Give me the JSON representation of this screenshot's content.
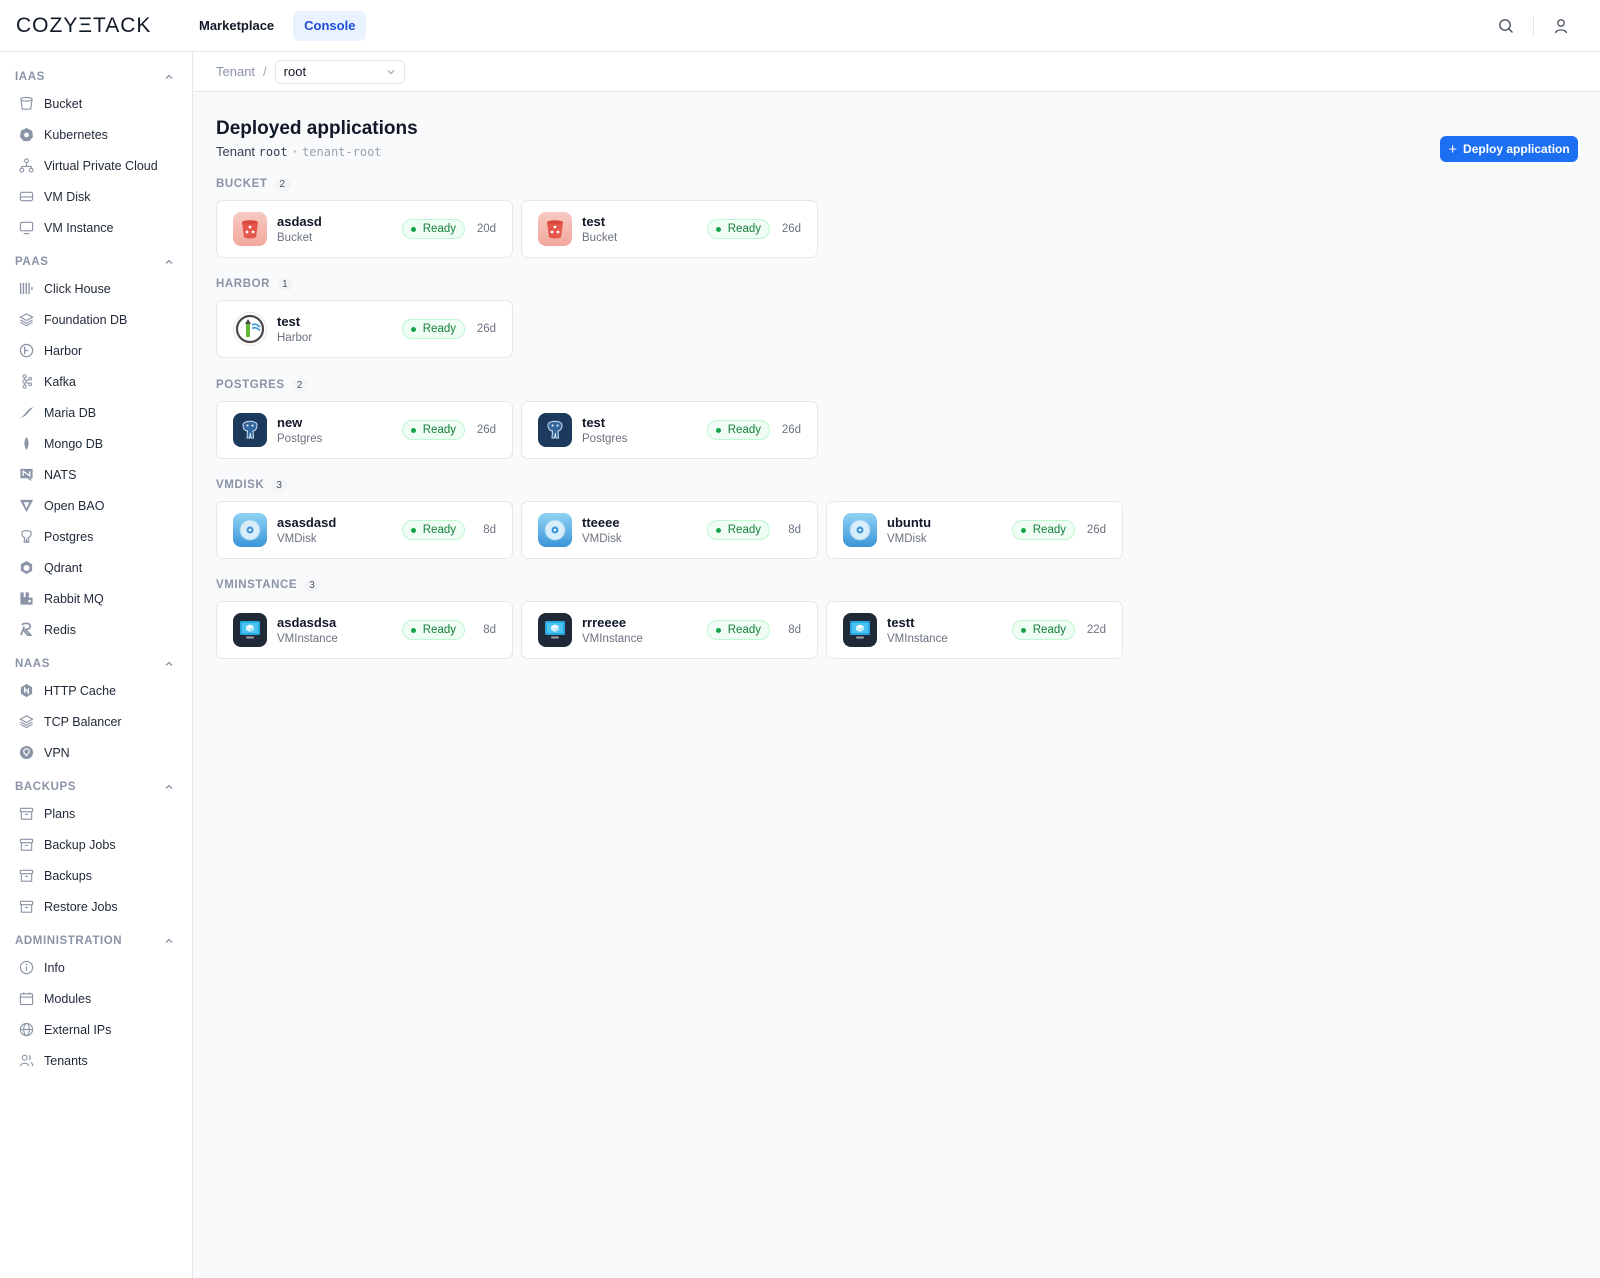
{
  "topbar": {
    "logo": "COZYΞTACK",
    "tabs": [
      {
        "label": "Marketplace",
        "active": false
      },
      {
        "label": "Console",
        "active": true
      }
    ]
  },
  "sidebar": {
    "sections": [
      {
        "title": "IAAS",
        "items": [
          {
            "label": "Bucket",
            "icon": "bucket-icon"
          },
          {
            "label": "Kubernetes",
            "icon": "kubernetes-icon"
          },
          {
            "label": "Virtual Private Cloud",
            "icon": "network-icon"
          },
          {
            "label": "VM Disk",
            "icon": "disk-icon"
          },
          {
            "label": "VM Instance",
            "icon": "monitor-icon"
          }
        ]
      },
      {
        "title": "PAAS",
        "items": [
          {
            "label": "Click House",
            "icon": "clickhouse-icon"
          },
          {
            "label": "Foundation DB",
            "icon": "layers-icon"
          },
          {
            "label": "Harbor",
            "icon": "harbor-icon"
          },
          {
            "label": "Kafka",
            "icon": "kafka-icon"
          },
          {
            "label": "Maria DB",
            "icon": "mariadb-icon"
          },
          {
            "label": "Mongo DB",
            "icon": "mongodb-icon"
          },
          {
            "label": "NATS",
            "icon": "nats-icon"
          },
          {
            "label": "Open BAO",
            "icon": "openbao-icon"
          },
          {
            "label": "Postgres",
            "icon": "postgres-icon"
          },
          {
            "label": "Qdrant",
            "icon": "qdrant-icon"
          },
          {
            "label": "Rabbit MQ",
            "icon": "rabbitmq-icon"
          },
          {
            "label": "Redis",
            "icon": "redis-icon"
          }
        ]
      },
      {
        "title": "NAAS",
        "items": [
          {
            "label": "HTTP Cache",
            "icon": "http-cache-icon"
          },
          {
            "label": "TCP Balancer",
            "icon": "layers-icon"
          },
          {
            "label": "VPN",
            "icon": "vpn-icon"
          }
        ]
      },
      {
        "title": "BACKUPS",
        "items": [
          {
            "label": "Plans",
            "icon": "archive-icon"
          },
          {
            "label": "Backup Jobs",
            "icon": "archive-icon"
          },
          {
            "label": "Backups",
            "icon": "archive-icon"
          },
          {
            "label": "Restore Jobs",
            "icon": "archive-icon"
          }
        ]
      },
      {
        "title": "ADMINISTRATION",
        "items": [
          {
            "label": "Info",
            "icon": "info-icon"
          },
          {
            "label": "Modules",
            "icon": "calendar-icon"
          },
          {
            "label": "External IPs",
            "icon": "globe-icon"
          },
          {
            "label": "Tenants",
            "icon": "users-icon"
          }
        ]
      }
    ]
  },
  "breadcrumb": {
    "tenant_label": "Tenant",
    "separator": "/",
    "selected": "root"
  },
  "page": {
    "title": "Deployed applications",
    "sub_prefix": "Tenant",
    "tenant": "root",
    "sub_sep": "·",
    "namespace": "tenant-root",
    "deploy_label": "Deploy application"
  },
  "groups": [
    {
      "title": "BUCKET",
      "count": "2",
      "apps": [
        {
          "name": "asdasd",
          "type": "Bucket",
          "status": "Ready",
          "age": "20d",
          "icon": "bucket"
        },
        {
          "name": "test",
          "type": "Bucket",
          "status": "Ready",
          "age": "26d",
          "icon": "bucket"
        }
      ]
    },
    {
      "title": "HARBOR",
      "count": "1",
      "apps": [
        {
          "name": "test",
          "type": "Harbor",
          "status": "Ready",
          "age": "26d",
          "icon": "harbor"
        }
      ]
    },
    {
      "title": "POSTGRES",
      "count": "2",
      "apps": [
        {
          "name": "new",
          "type": "Postgres",
          "status": "Ready",
          "age": "26d",
          "icon": "pg"
        },
        {
          "name": "test",
          "type": "Postgres",
          "status": "Ready",
          "age": "26d",
          "icon": "pg"
        }
      ]
    },
    {
      "title": "VMDISK",
      "count": "3",
      "apps": [
        {
          "name": "asasdasd",
          "type": "VMDisk",
          "status": "Ready",
          "age": "8d",
          "icon": "disk"
        },
        {
          "name": "tteeee",
          "type": "VMDisk",
          "status": "Ready",
          "age": "8d",
          "icon": "disk"
        },
        {
          "name": "ubuntu",
          "type": "VMDisk",
          "status": "Ready",
          "age": "26d",
          "icon": "disk"
        }
      ]
    },
    {
      "title": "VMINSTANCE",
      "count": "3",
      "apps": [
        {
          "name": "asdasdsa",
          "type": "VMInstance",
          "status": "Ready",
          "age": "8d",
          "icon": "vm"
        },
        {
          "name": "rrreeee",
          "type": "VMInstance",
          "status": "Ready",
          "age": "8d",
          "icon": "vm"
        },
        {
          "name": "testt",
          "type": "VMInstance",
          "status": "Ready",
          "age": "22d",
          "icon": "vm"
        }
      ]
    }
  ],
  "colors": {
    "accent": "#1d6ff2",
    "ready_green": "#16a34a",
    "bg": "#f8fafc"
  }
}
